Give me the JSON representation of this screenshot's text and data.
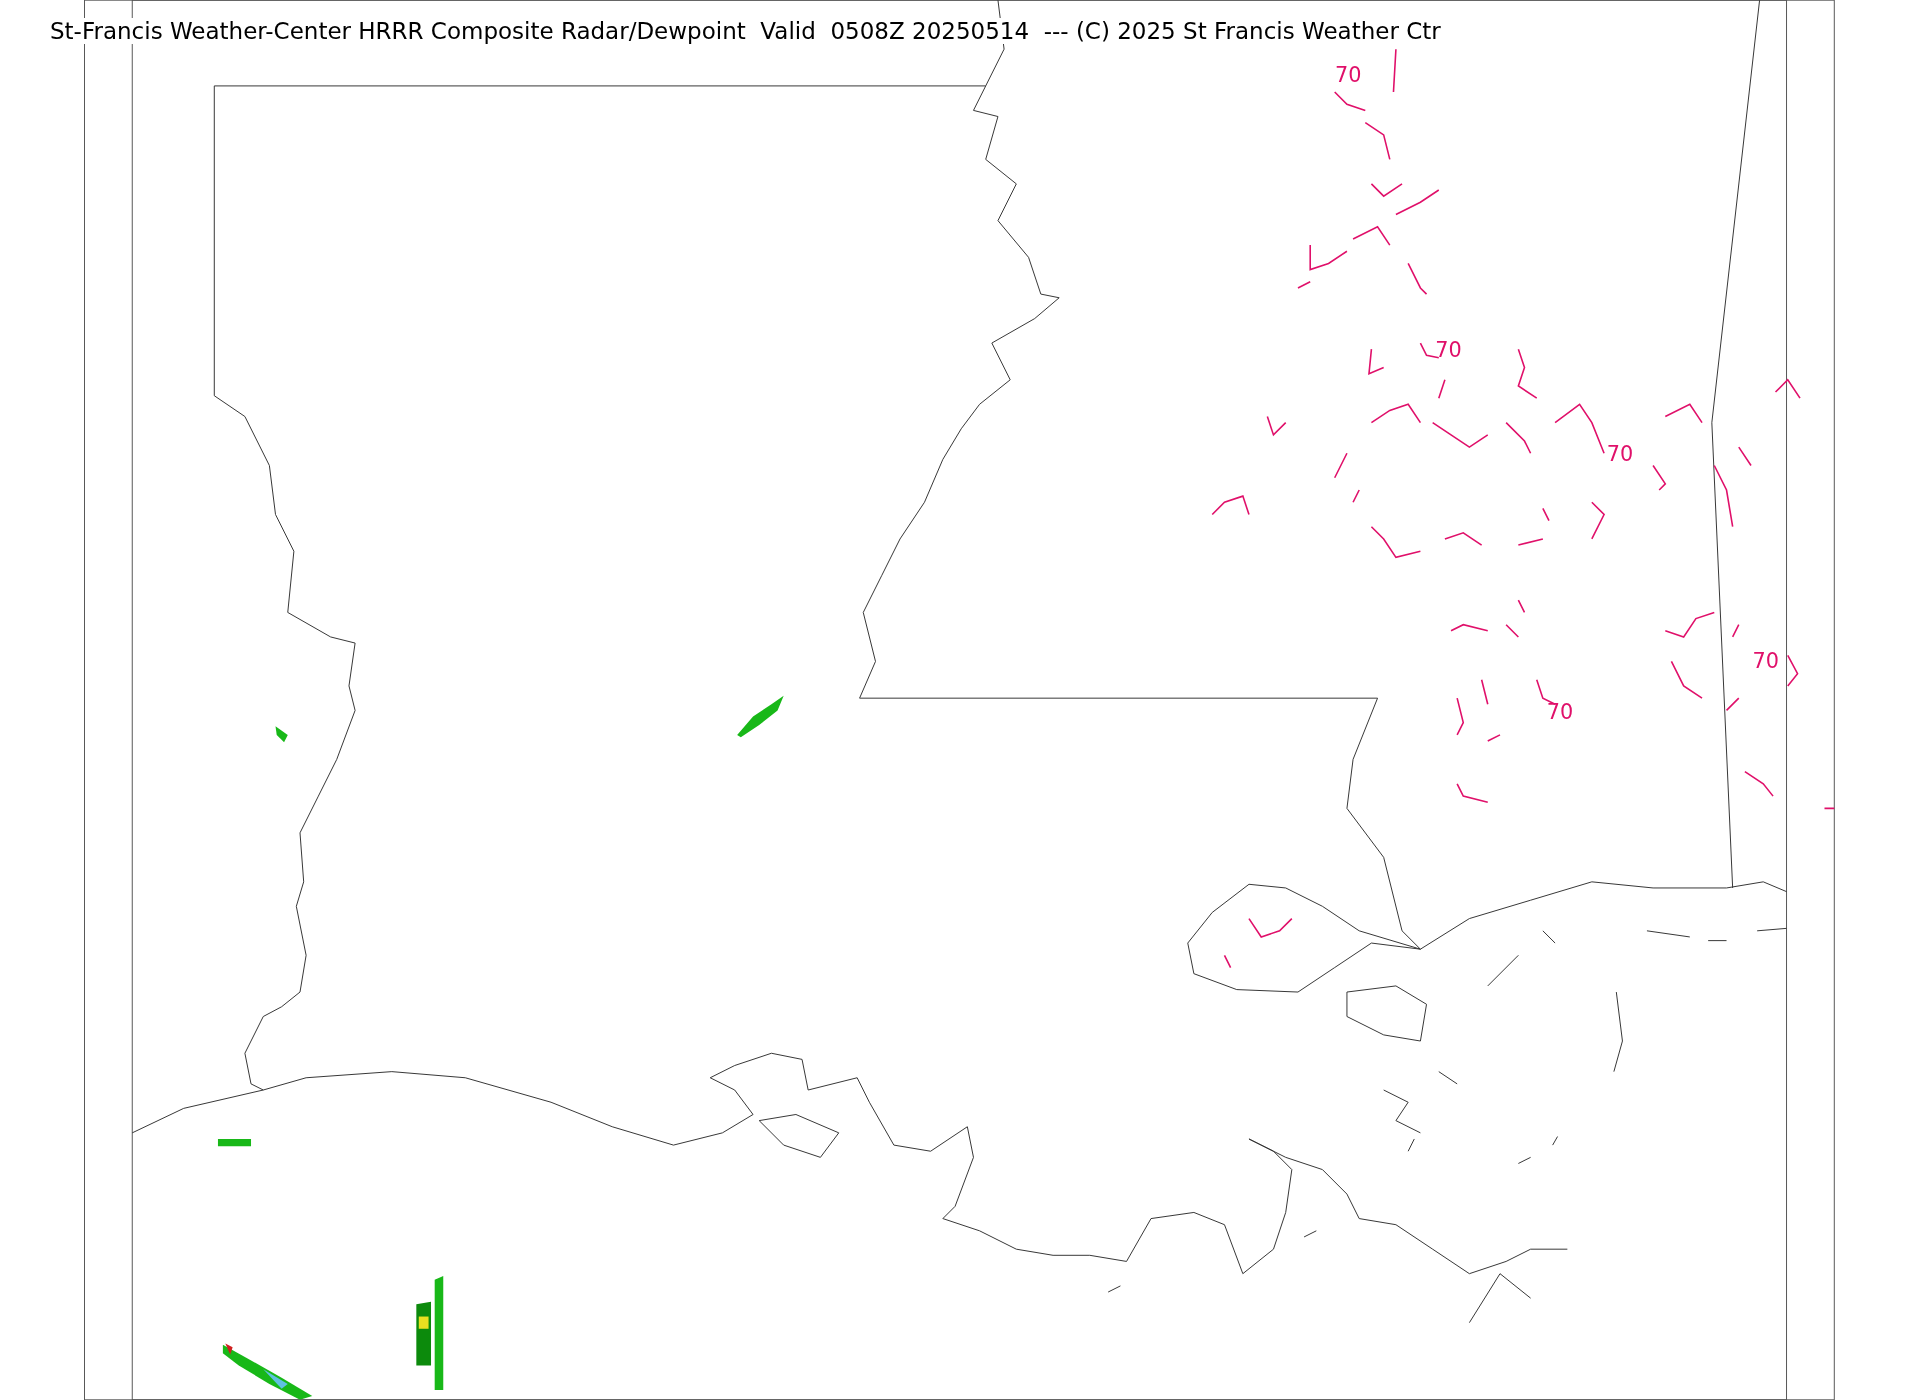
{
  "title": "St-Francis Weather-Center HRRR Composite Radar/Dewpoint  Valid  0508Z 20250514  --- (C) 2025 St Francis Weather Ctr",
  "contour_labels": [
    {
      "text": "70"
    },
    {
      "text": "70"
    },
    {
      "text": "70"
    },
    {
      "text": "70"
    },
    {
      "text": "70"
    }
  ]
}
